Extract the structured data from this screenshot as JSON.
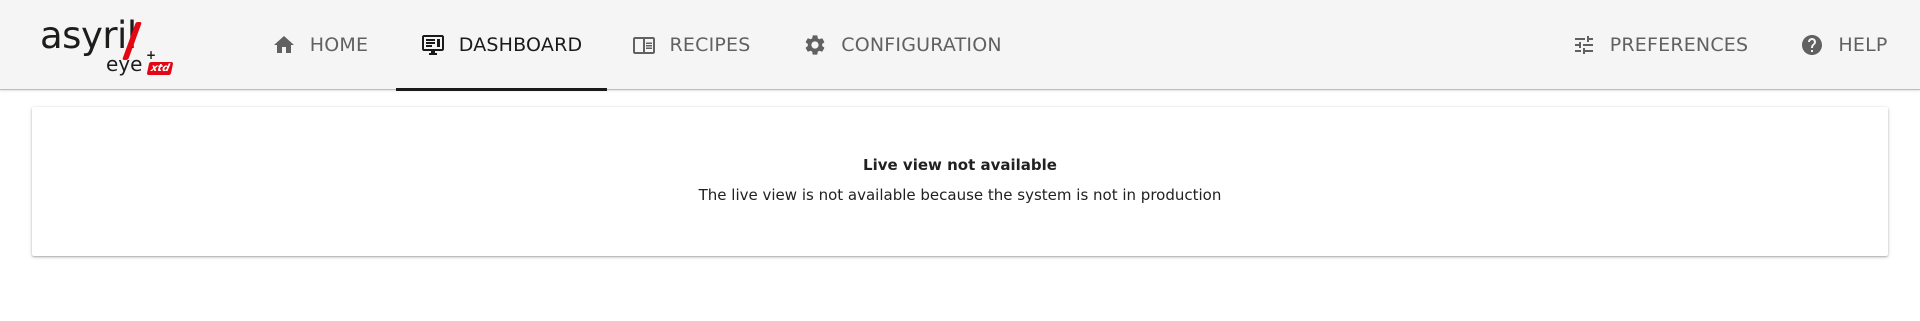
{
  "logo": {
    "wordmark": "asyril",
    "product": "eye",
    "plus": "+",
    "badge": "xtd",
    "brand_color": "#e30613"
  },
  "nav": {
    "tabs": [
      {
        "label": "HOME",
        "icon": "home-icon",
        "active": false
      },
      {
        "label": "DASHBOARD",
        "icon": "monitor-icon",
        "active": true
      },
      {
        "label": "RECIPES",
        "icon": "book-icon",
        "active": false
      },
      {
        "label": "CONFIGURATION",
        "icon": "gear-icon",
        "active": false
      }
    ],
    "right_tabs": [
      {
        "label": "PREFERENCES",
        "icon": "sliders-icon",
        "active": false
      },
      {
        "label": "HELP",
        "icon": "help-circle-icon",
        "active": false
      }
    ]
  },
  "main": {
    "live_view": {
      "title": "Live view not available",
      "message": "The live view is not available because the system is not in production"
    }
  },
  "colors": {
    "header_background": "#f5f5f5",
    "active_tab": "#1a1a1a",
    "inactive_tab": "#616161"
  }
}
